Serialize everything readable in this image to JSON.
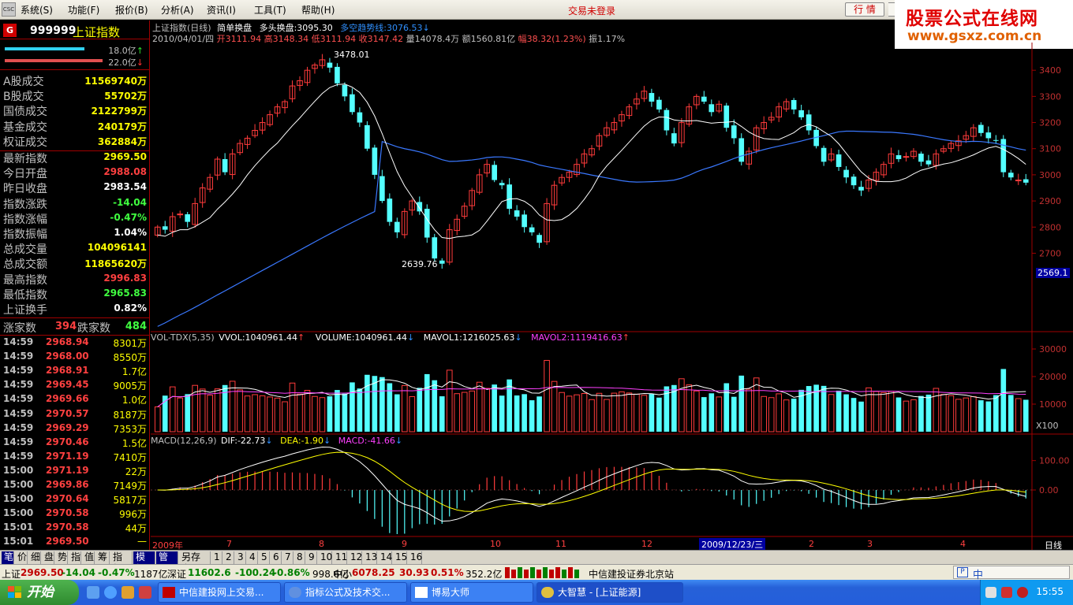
{
  "menu": {
    "items": [
      "系统(S)",
      "功能(F)",
      "报价(B)",
      "分析(A)",
      "资讯(I)",
      "工具(T)",
      "帮助(H)"
    ],
    "status": "交易未登录",
    "quote_button": "行 情",
    "logo_text": "CSC"
  },
  "watermark": {
    "line1": "股票公式在线网",
    "line2": "www.gsxz.com.cn"
  },
  "index_panel": {
    "badge": "G",
    "code": "999999",
    "name": "上证指数",
    "bars": [
      {
        "value": "18.0亿",
        "arrow": "↑",
        "fill": 0.56,
        "color": "#30d0f0"
      },
      {
        "value": "22.0亿",
        "arrow": "↓",
        "fill": 0.69,
        "color": "#e05050"
      }
    ],
    "turnover": [
      {
        "label": "A股成交",
        "value": "11569740万",
        "color": "#ffff00"
      },
      {
        "label": "B股成交",
        "value": "55702万",
        "color": "#ffff00"
      },
      {
        "label": "国债成交",
        "value": "2122799万",
        "color": "#ffff00"
      },
      {
        "label": "基金成交",
        "value": "240179万",
        "color": "#ffff00"
      },
      {
        "label": "权证成交",
        "value": "362884万",
        "color": "#ffff00"
      }
    ],
    "quotes": [
      {
        "label": "最新指数",
        "value": "2969.50",
        "color": "#ffff00"
      },
      {
        "label": "今日开盘",
        "value": "2988.08",
        "color": "#ff4040"
      },
      {
        "label": "昨日收盘",
        "value": "2983.54",
        "color": "#ffffff"
      },
      {
        "label": "指数涨跌",
        "value": "-14.04",
        "color": "#40ff40"
      },
      {
        "label": "指数涨幅",
        "value": "-0.47%",
        "color": "#40ff40"
      },
      {
        "label": "指数振幅",
        "value": "1.04%",
        "color": "#ffffff"
      },
      {
        "label": "总成交量",
        "value": "104096141",
        "color": "#ffff00"
      },
      {
        "label": "总成交额",
        "value": "11865620万",
        "color": "#ffff00"
      },
      {
        "label": "最高指数",
        "value": "2996.83",
        "color": "#ff4040"
      },
      {
        "label": "最低指数",
        "value": "2965.83",
        "color": "#40ff40"
      },
      {
        "label": "上证换手",
        "value": "0.82%",
        "color": "#ffffff"
      }
    ],
    "advance_label": "涨家数",
    "advance_value": "394",
    "decline_label": "跌家数",
    "decline_value": "484"
  },
  "ticks": [
    {
      "time": "14:59",
      "price": "2968.94",
      "vol": "8301万"
    },
    {
      "time": "14:59",
      "price": "2968.00",
      "vol": "8550万"
    },
    {
      "time": "14:59",
      "price": "2968.91",
      "vol": "1.7亿"
    },
    {
      "time": "14:59",
      "price": "2969.45",
      "vol": "9005万"
    },
    {
      "time": "14:59",
      "price": "2969.66",
      "vol": "1.0亿"
    },
    {
      "time": "14:59",
      "price": "2970.57",
      "vol": "8187万"
    },
    {
      "time": "14:59",
      "price": "2969.29",
      "vol": "7353万"
    },
    {
      "time": "14:59",
      "price": "2970.46",
      "vol": "1.5亿"
    },
    {
      "time": "14:59",
      "price": "2971.19",
      "vol": "7410万"
    },
    {
      "time": "15:00",
      "price": "2971.19",
      "vol": "22万"
    },
    {
      "time": "15:00",
      "price": "2969.86",
      "vol": "7149万"
    },
    {
      "time": "15:00",
      "price": "2970.64",
      "vol": "5817万"
    },
    {
      "time": "15:00",
      "price": "2970.58",
      "vol": "996万"
    },
    {
      "time": "15:01",
      "price": "2970.58",
      "vol": "44万"
    },
    {
      "time": "15:01",
      "price": "2969.50",
      "vol": "—"
    }
  ],
  "chart": {
    "title": "上证指数(日线)",
    "ind1": "简单换盘",
    "ind2": "多头换盘:3095.30",
    "ind3": "多空趋势线:3076.53",
    "ind3_arrow": "↓",
    "info_date": "2010/04/01/四",
    "info_open": "开3111.94",
    "info_high": "高3148.34",
    "info_low": "低3111.94",
    "info_close": "收3147.42",
    "info_vol": "量14078.4万",
    "info_amt": "额1560.81亿",
    "info_chg": "幅38.32(1.23%)",
    "info_amp": "振1.17%",
    "max_label": "3478.01",
    "min_label": "2639.76",
    "current_tag": "2569.1",
    "vol_title": "VOL-TDX(5,35)",
    "vol_vvol": "VVOL:1040961.44",
    "vol_volume": "VOLUME:1040961.44",
    "vol_mavol1": "MAVOL1:1216025.63",
    "vol_mavol2": "MAVOL2:1119416.63",
    "vol_unit": "X100",
    "macd_title": "MACD(12,26,9)",
    "macd_dif": "DIF:-22.73",
    "macd_dea": "DEA:-1.90",
    "macd_macd": "MACD:-41.66",
    "cursor_date": "2009/12/23/三",
    "period": "日线",
    "x_year": "2009年",
    "x_months": [
      "7",
      "8",
      "9",
      "10",
      "11",
      "12",
      "2",
      "3",
      "4"
    ]
  },
  "chart_data": [
    {
      "type": "candlestick",
      "title": "上证指数(日线)",
      "ylim": [
        2400,
        3500
      ],
      "yticks": [
        2700,
        2800,
        2900,
        3000,
        3100,
        3200,
        3300,
        3400
      ],
      "key_points": {
        "high": 3478.01,
        "low": 2639.76,
        "last_close": 2969.5
      },
      "close": [
        2800,
        2790,
        2840,
        2850,
        2820,
        2890,
        2950,
        2990,
        3060,
        3010,
        3080,
        3120,
        3140,
        3170,
        3200,
        3230,
        3260,
        3280,
        3340,
        3360,
        3400,
        3420,
        3440,
        3410,
        3350,
        3300,
        3240,
        3200,
        3100,
        3000,
        2900,
        2820,
        2780,
        2860,
        2900,
        2860,
        2760,
        2680,
        2660,
        2790,
        2830,
        2880,
        2940,
        3000,
        3040,
        2980,
        2960,
        2870,
        2840,
        2800,
        2780,
        2740,
        2890,
        2960,
        2990,
        3010,
        3040,
        3080,
        3100,
        3150,
        3180,
        3200,
        3230,
        3260,
        3290,
        3320,
        3280,
        3250,
        3170,
        3120,
        3200,
        3260,
        3300,
        3280,
        3240,
        3270,
        3180,
        3140,
        3050,
        3090,
        3180,
        3200,
        3220,
        3260,
        3280,
        3250,
        3220,
        3170,
        3110,
        3050,
        3080,
        3030,
        2990,
        2960,
        2940,
        2980,
        3010,
        3040,
        3080,
        3060,
        3070,
        3090,
        3050,
        3040,
        3080,
        3100,
        3120,
        3130,
        3150,
        3180,
        3160,
        3140,
        3130,
        3010,
        2990,
        2980,
        2970
      ],
      "volume_ylim": [
        0,
        32000
      ],
      "volume_yticks": [
        10000,
        20000,
        30000
      ],
      "macd_ylim": [
        -150,
        150
      ],
      "macd_yticks": [
        0,
        100
      ]
    }
  ],
  "tabs": {
    "items": [
      "笔",
      "价",
      "细",
      "盘",
      "势",
      "指",
      "值",
      "筹",
      "指标",
      "模板",
      "管理",
      "另存为",
      "1",
      "2",
      "3",
      "4",
      "5",
      "6",
      "7",
      "8",
      "9",
      "10",
      "11",
      "12",
      "13",
      "14",
      "15",
      "16"
    ],
    "active": [
      "笔",
      "模板",
      "管理"
    ]
  },
  "statusbar": {
    "sh_label": "上证",
    "sh_price": "2969.50",
    "sh_chg": "-14.04",
    "sh_pct": "-0.47%",
    "sh_amt": "1187亿",
    "sz_label": "深证",
    "sz_price": "11602.6",
    "sz_chg": "-100.24",
    "sz_pct": "-0.86%",
    "sz_amt": "998.6亿",
    "zx_label": "中小",
    "zx_price": "6078.25",
    "zx_chg": "30.93",
    "zx_pct": "0.51%",
    "zx_amt": "352.2亿",
    "broker": "中信建投证券北京站",
    "ime": "中"
  },
  "taskbar": {
    "start": "开始",
    "tasks": [
      "中信建投网上交易...",
      "指标公式及技术交...",
      "博易大师",
      "大智慧 - [上证能源]"
    ],
    "clock": "15:55"
  }
}
